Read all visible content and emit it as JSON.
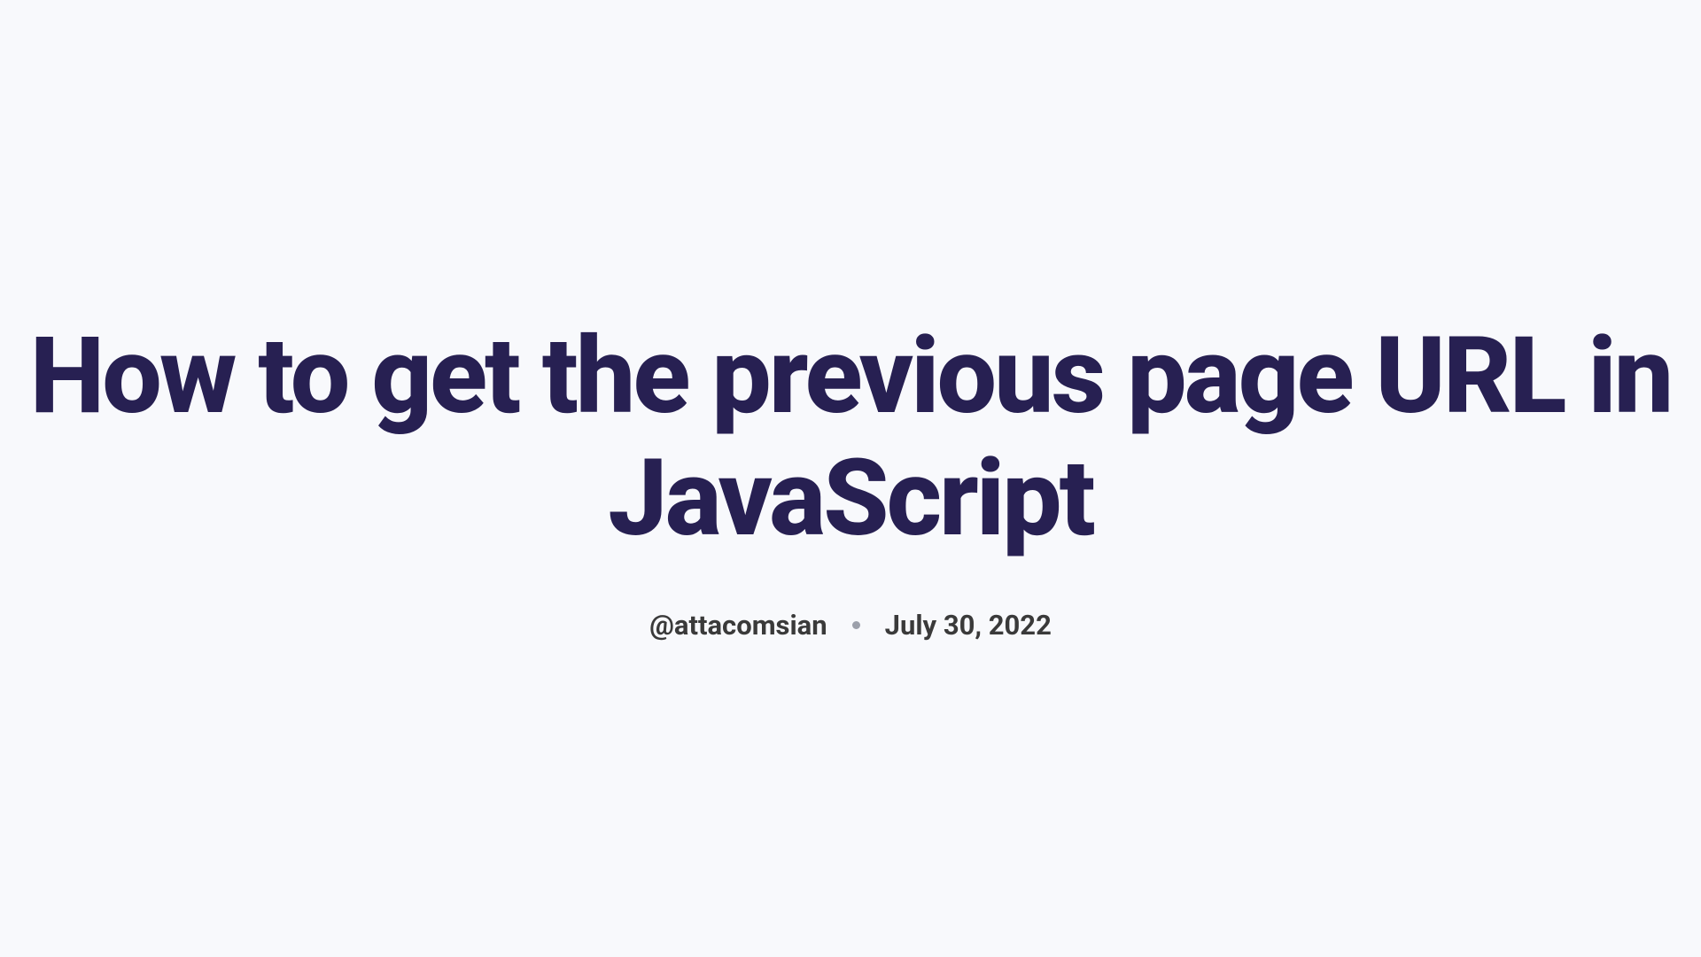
{
  "title": "How to get the previous page URL in JavaScript",
  "author": "@attacomsian",
  "date": "July 30, 2022"
}
